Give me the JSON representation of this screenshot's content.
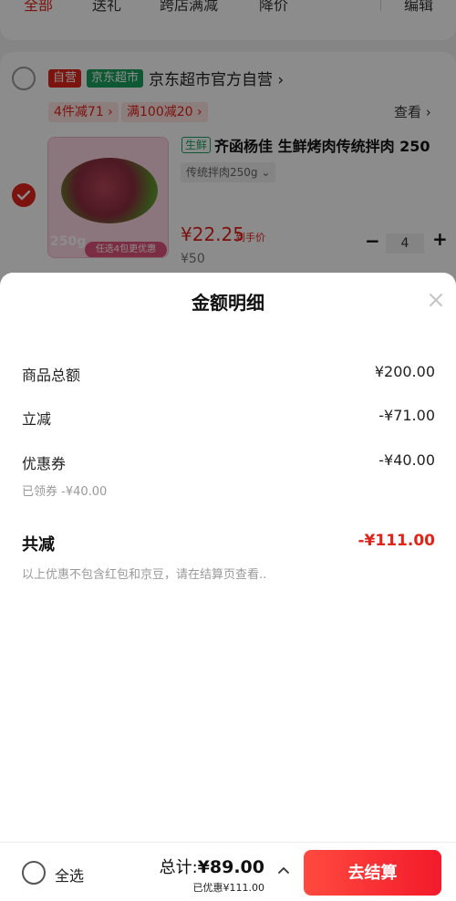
{
  "background": {
    "tabs": [
      {
        "label": "全部"
      },
      {
        "label": "送礼"
      },
      {
        "label": "跨店满减"
      },
      {
        "label": "降价"
      },
      {
        "label": "编辑"
      }
    ],
    "store": {
      "tag_self": "自营",
      "tag_supermarket": "京东超市",
      "name": "京东超市官方自营",
      "chevron": "›",
      "promo1": "4件减71 ›",
      "promo2": "满100减20 ›",
      "view_link": "查看 ›"
    },
    "product": {
      "fresh_tag": "生鲜",
      "title": "齐函杨佳 生鲜烤肉传统拌肉 250",
      "variant": "传统拌肉250g ⌄",
      "image_weight": "250g",
      "image_banner": "任选4包更优惠",
      "price": "¥22.25",
      "price_tag": "到手价",
      "original_price": "¥50",
      "qty_minus": "−",
      "quantity": "4",
      "qty_plus": "+"
    }
  },
  "sheet": {
    "title": "金额明细",
    "rows": [
      {
        "label": "商品总额",
        "value": "¥200.00"
      },
      {
        "label": "立减",
        "value": "-¥71.00"
      },
      {
        "label": "优惠券",
        "value": "-¥40.00",
        "sub": "已领券 -¥40.00"
      }
    ],
    "total_label": "共减",
    "total_value": "-¥111.00",
    "note": "以上优惠不包含红包和京豆，请在结算页查看.."
  },
  "bottom_bar": {
    "select_all": "全选",
    "sum_label": "总计:",
    "sum_value": "¥89.00",
    "saved": "已优惠¥111.00",
    "checkout": "去结算"
  },
  "colors": {
    "accent_red": "#e2231a",
    "supermarket_green": "#1aa260"
  }
}
